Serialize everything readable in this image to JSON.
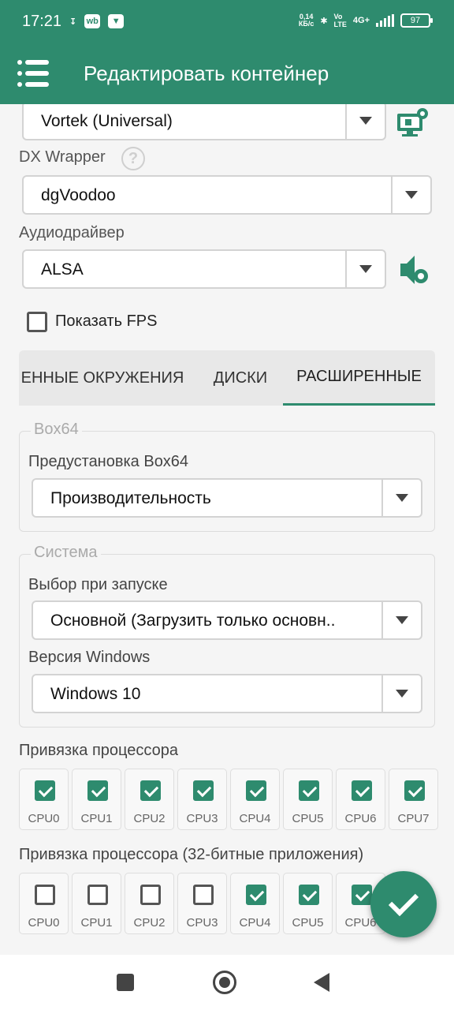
{
  "status_bar": {
    "time": "17:21",
    "speed_value": "0,14",
    "speed_unit": "КБ/с",
    "network": "4G+",
    "battery": "97"
  },
  "app_bar": {
    "title": "Редактировать контейнер"
  },
  "graphics_driver": {
    "value": "Vortek (Universal)"
  },
  "dx_wrapper": {
    "label": "DX Wrapper",
    "value": "dgVoodoo",
    "help": "?"
  },
  "audio_driver": {
    "label": "Аудиодрайвер",
    "value": "ALSA"
  },
  "show_fps": {
    "label": "Показать FPS",
    "checked": false
  },
  "tabs": [
    {
      "label": "ЕННЫЕ ОКРУЖЕНИЯ",
      "active": false
    },
    {
      "label": "ДИСКИ",
      "active": false
    },
    {
      "label": "РАСШИРЕННЫЕ",
      "active": true
    }
  ],
  "box64_group": {
    "title": "Box64",
    "preset_label": "Предустановка Box64",
    "preset_value": "Производительность"
  },
  "system_group": {
    "title": "Система",
    "startup_label": "Выбор при запуске",
    "startup_value": "Основной (Загрузить только основн..",
    "windows_label": "Версия Windows",
    "windows_value": "Windows 10"
  },
  "cpu_affinity": {
    "label": "Привязка процессора",
    "cpus": [
      "CPU0",
      "CPU1",
      "CPU2",
      "CPU3",
      "CPU4",
      "CPU5",
      "CPU6",
      "CPU7"
    ],
    "checked": [
      true,
      true,
      true,
      true,
      true,
      true,
      true,
      true
    ]
  },
  "cpu_affinity_32": {
    "label": "Привязка процессора (32-битные приложения)",
    "cpus": [
      "CPU0",
      "CPU1",
      "CPU2",
      "CPU3",
      "CPU4",
      "CPU5",
      "CPU6"
    ],
    "checked": [
      false,
      false,
      false,
      false,
      true,
      true,
      true
    ]
  },
  "colors": {
    "accent": "#2e8b6e"
  },
  "icons": {
    "menu": "menu-icon",
    "graphics_settings": "monitor-gear-icon",
    "audio_settings": "speaker-gear-icon",
    "save": "check-icon"
  }
}
